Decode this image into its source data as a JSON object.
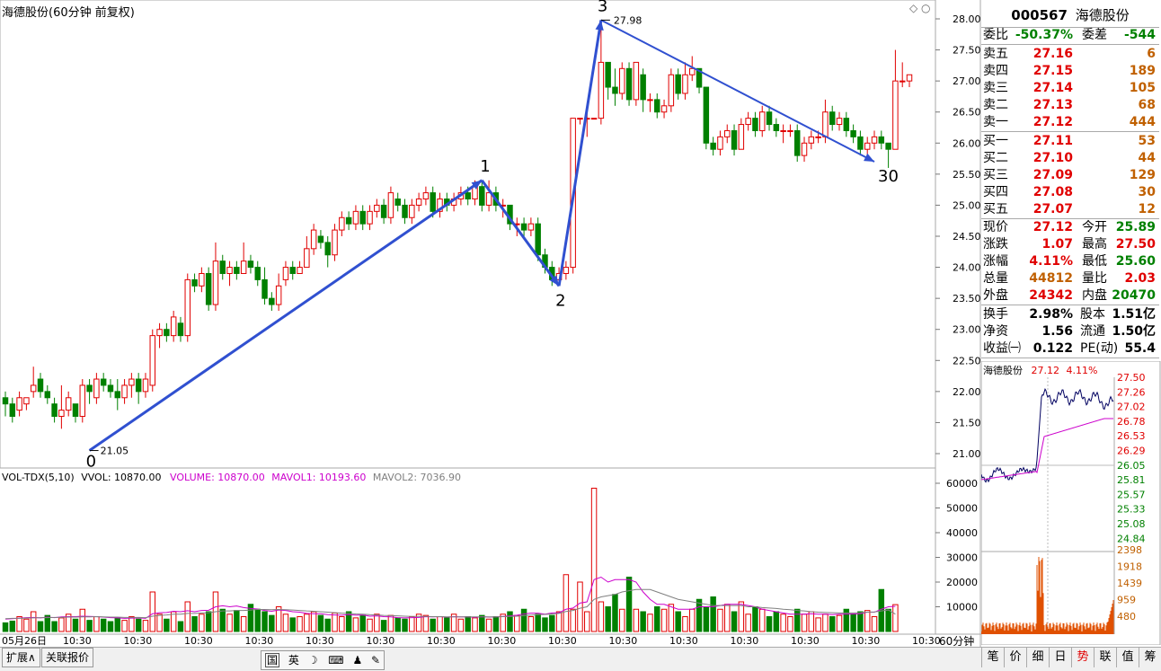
{
  "title": "海德股份(60分钟 前复权)",
  "stock": {
    "code": "000567",
    "name": "海德股份"
  },
  "chart_data": {
    "type": "candlestick",
    "price_axis": {
      "ticks": [
        "28.00",
        "27.50",
        "27.00",
        "26.50",
        "26.00",
        "25.50",
        "25.00",
        "24.50",
        "24.00",
        "23.50",
        "23.00",
        "22.50",
        "22.00",
        "21.50",
        "21.00"
      ],
      "ylim": [
        20.6,
        28.15
      ]
    },
    "candles": [
      [
        21.9,
        21.8,
        22.0,
        21.6
      ],
      [
        21.8,
        21.6,
        21.9,
        21.5
      ],
      [
        21.7,
        21.9,
        22.0,
        21.6
      ],
      [
        21.8,
        21.9,
        21.9,
        21.7
      ],
      [
        22.0,
        22.1,
        22.4,
        21.9
      ],
      [
        22.2,
        22.0,
        22.3,
        21.9
      ],
      [
        22.0,
        21.9,
        22.1,
        21.8
      ],
      [
        21.8,
        21.6,
        21.9,
        21.5
      ],
      [
        21.6,
        21.7,
        22.1,
        21.4
      ],
      [
        21.7,
        21.9,
        22.0,
        21.6
      ],
      [
        21.8,
        21.6,
        21.8,
        21.5
      ],
      [
        21.6,
        22.1,
        22.2,
        21.5
      ],
      [
        22.1,
        22.0,
        22.2,
        21.8
      ],
      [
        21.9,
        22.2,
        22.3,
        21.8
      ],
      [
        22.2,
        22.1,
        22.3,
        22.0
      ],
      [
        22.1,
        22.0,
        22.2,
        21.9
      ],
      [
        22.0,
        21.9,
        22.2,
        21.7
      ],
      [
        21.9,
        22.1,
        22.2,
        21.8
      ],
      [
        22.1,
        22.2,
        22.3,
        21.9
      ],
      [
        22.2,
        22.0,
        22.3,
        21.8
      ],
      [
        22.0,
        22.2,
        22.3,
        21.9
      ],
      [
        22.1,
        22.9,
        23.0,
        22.0
      ],
      [
        22.9,
        23.0,
        23.1,
        22.7
      ],
      [
        23.0,
        22.9,
        23.1,
        22.8
      ],
      [
        22.9,
        23.2,
        23.3,
        22.8
      ],
      [
        23.1,
        22.9,
        23.2,
        22.8
      ],
      [
        22.9,
        23.8,
        23.9,
        22.8
      ],
      [
        23.8,
        23.7,
        23.9,
        23.6
      ],
      [
        23.7,
        23.9,
        24.0,
        23.6
      ],
      [
        23.9,
        23.4,
        24.0,
        23.3
      ],
      [
        23.4,
        24.1,
        24.4,
        23.3
      ],
      [
        24.1,
        23.9,
        24.2,
        23.8
      ],
      [
        23.9,
        24.0,
        24.1,
        23.7
      ],
      [
        24.0,
        23.9,
        24.1,
        23.8
      ],
      [
        23.9,
        24.1,
        24.4,
        23.9
      ],
      [
        24.1,
        24.0,
        24.2,
        23.9
      ],
      [
        24.0,
        23.8,
        24.1,
        23.7
      ],
      [
        23.8,
        23.5,
        24.0,
        23.4
      ],
      [
        23.5,
        23.4,
        23.6,
        23.3
      ],
      [
        23.4,
        23.7,
        23.9,
        23.3
      ],
      [
        23.8,
        24.0,
        24.1,
        23.7
      ],
      [
        24.0,
        23.9,
        24.1,
        23.8
      ],
      [
        23.9,
        24.0,
        24.1,
        23.9
      ],
      [
        24.0,
        24.3,
        24.5,
        24.0
      ],
      [
        24.3,
        24.6,
        24.7,
        24.2
      ],
      [
        24.5,
        24.4,
        24.6,
        24.3
      ],
      [
        24.4,
        24.2,
        24.5,
        24.0
      ],
      [
        24.2,
        24.6,
        24.7,
        24.1
      ],
      [
        24.6,
        24.8,
        24.9,
        24.5
      ],
      [
        24.8,
        24.7,
        24.9,
        24.6
      ],
      [
        24.7,
        24.9,
        25.0,
        24.6
      ],
      [
        24.9,
        24.7,
        25.0,
        24.6
      ],
      [
        24.7,
        24.9,
        25.0,
        24.6
      ],
      [
        24.9,
        25.0,
        25.1,
        24.8
      ],
      [
        25.0,
        24.8,
        25.1,
        24.7
      ],
      [
        24.8,
        25.2,
        25.3,
        24.7
      ],
      [
        25.1,
        25.0,
        25.2,
        24.9
      ],
      [
        25.0,
        24.8,
        25.1,
        24.7
      ],
      [
        24.8,
        25.0,
        25.1,
        24.7
      ],
      [
        25.0,
        25.1,
        25.2,
        24.9
      ],
      [
        25.1,
        25.2,
        25.3,
        25.0
      ],
      [
        25.2,
        24.9,
        25.3,
        24.8
      ],
      [
        24.9,
        25.1,
        25.2,
        24.8
      ],
      [
        25.1,
        25.0,
        25.2,
        24.9
      ],
      [
        25.0,
        25.1,
        25.2,
        24.9
      ],
      [
        25.1,
        25.2,
        25.3,
        25.0
      ],
      [
        25.2,
        25.1,
        25.3,
        25.0
      ],
      [
        25.1,
        25.3,
        25.4,
        25.0
      ],
      [
        25.3,
        25.0,
        25.4,
        24.9
      ],
      [
        25.0,
        25.2,
        25.4,
        24.9
      ],
      [
        25.2,
        25.0,
        25.3,
        24.9
      ],
      [
        25.0,
        25.0,
        25.1,
        24.8
      ],
      [
        25.0,
        24.7,
        25.0,
        24.6
      ],
      [
        24.7,
        24.7,
        24.8,
        24.5
      ],
      [
        24.7,
        24.6,
        24.8,
        24.5
      ],
      [
        24.6,
        24.7,
        24.8,
        24.5
      ],
      [
        24.7,
        24.2,
        24.8,
        24.1
      ],
      [
        24.2,
        24.0,
        24.3,
        23.9
      ],
      [
        24.0,
        23.8,
        24.1,
        23.7
      ],
      [
        23.8,
        23.9,
        24.0,
        23.7
      ],
      [
        23.9,
        24.0,
        24.1,
        23.8
      ],
      [
        24.0,
        26.4,
        26.4,
        23.9
      ],
      [
        26.4,
        26.4,
        26.4,
        26.3
      ],
      [
        26.4,
        26.4,
        26.5,
        26.1
      ],
      [
        26.4,
        26.4,
        26.4,
        26.4
      ],
      [
        26.4,
        27.3,
        27.98,
        26.3
      ],
      [
        27.3,
        26.9,
        27.3,
        26.7
      ],
      [
        26.9,
        26.8,
        27.2,
        26.6
      ],
      [
        26.8,
        27.2,
        27.3,
        26.7
      ],
      [
        27.2,
        26.7,
        27.3,
        26.6
      ],
      [
        26.7,
        27.3,
        27.3,
        26.6
      ],
      [
        27.1,
        26.7,
        27.2,
        26.5
      ],
      [
        26.7,
        26.7,
        26.8,
        26.5
      ],
      [
        26.7,
        26.5,
        26.8,
        26.4
      ],
      [
        26.5,
        26.6,
        26.7,
        26.4
      ],
      [
        26.6,
        27.1,
        27.2,
        26.5
      ],
      [
        27.1,
        26.8,
        27.2,
        26.7
      ],
      [
        26.8,
        27.1,
        27.3,
        26.7
      ],
      [
        27.1,
        27.2,
        27.4,
        27.0
      ],
      [
        27.2,
        26.9,
        27.2,
        26.8
      ],
      [
        26.9,
        26.0,
        26.9,
        25.9
      ],
      [
        26.0,
        25.9,
        26.1,
        25.8
      ],
      [
        25.9,
        26.1,
        26.2,
        25.8
      ],
      [
        26.1,
        26.2,
        26.3,
        26.0
      ],
      [
        26.2,
        25.9,
        26.3,
        25.8
      ],
      [
        25.9,
        26.3,
        26.4,
        25.9
      ],
      [
        26.3,
        26.4,
        26.5,
        26.2
      ],
      [
        26.4,
        26.2,
        26.5,
        26.1
      ],
      [
        26.2,
        26.5,
        26.6,
        26.1
      ],
      [
        26.5,
        26.3,
        26.6,
        26.2
      ],
      [
        26.3,
        26.2,
        26.4,
        26.1
      ],
      [
        26.2,
        26.2,
        26.3,
        26.0
      ],
      [
        26.2,
        26.2,
        26.3,
        26.1
      ],
      [
        26.2,
        25.8,
        26.3,
        25.7
      ],
      [
        25.8,
        26.0,
        26.1,
        25.7
      ],
      [
        26.0,
        26.1,
        26.2,
        25.9
      ],
      [
        26.1,
        26.1,
        26.2,
        26.0
      ],
      [
        26.1,
        26.5,
        26.7,
        26.0
      ],
      [
        26.5,
        26.3,
        26.6,
        26.2
      ],
      [
        26.3,
        26.4,
        26.5,
        26.2
      ],
      [
        26.4,
        26.2,
        26.5,
        26.1
      ],
      [
        26.2,
        26.1,
        26.3,
        26.0
      ],
      [
        26.1,
        25.9,
        26.2,
        25.8
      ],
      [
        25.9,
        26.0,
        26.1,
        25.8
      ],
      [
        26.0,
        26.1,
        26.2,
        25.9
      ],
      [
        26.1,
        26.0,
        26.2,
        25.9
      ],
      [
        26.0,
        25.9,
        26.0,
        25.6
      ],
      [
        25.9,
        27.0,
        27.5,
        25.9
      ],
      [
        27.0,
        27.0,
        27.3,
        26.9
      ],
      [
        27.0,
        27.1,
        27.1,
        26.9
      ]
    ],
    "zigzag": {
      "points": [
        [
          12,
          21.05
        ],
        [
          68,
          25.4
        ],
        [
          79,
          23.7
        ],
        [
          85,
          27.98
        ],
        [
          124,
          25.7
        ]
      ],
      "labels": [
        "0",
        "1",
        "2",
        "3",
        "30"
      ],
      "price_labels": [
        "21.05",
        "27.98"
      ]
    },
    "volume": {
      "header": [
        "VOL-TDX(5,10)",
        "VVOL: 10870.00",
        "VOLUME: 10870.00",
        "MAVOL1: 10193.60",
        "MAVOL2: 7036.90"
      ],
      "ticks": [
        "60000",
        "50000",
        "40000",
        "30000",
        "20000",
        "10000"
      ],
      "ylim": [
        0,
        63000
      ],
      "values": [
        3500,
        4200,
        6000,
        5000,
        8000,
        4000,
        6500,
        4000,
        5500,
        7000,
        5000,
        9000,
        4500,
        6000,
        5000,
        4000,
        5500,
        4500,
        6000,
        5000,
        4500,
        16000,
        7000,
        5000,
        8000,
        4000,
        12000,
        6000,
        7000,
        8000,
        16000,
        9000,
        7000,
        8500,
        6000,
        11000,
        9000,
        8000,
        6500,
        10000,
        7000,
        5500,
        6000,
        7000,
        8000,
        6500,
        5000,
        7500,
        6000,
        8000,
        5500,
        6500,
        5000,
        7000,
        4500,
        6500,
        5500,
        5000,
        6000,
        7000,
        6500,
        5000,
        6000,
        5500,
        7000,
        5000,
        6000,
        5500,
        6500,
        5000,
        6000,
        7000,
        8000,
        6500,
        9000,
        6000,
        7000,
        5500,
        6500,
        8000,
        23000,
        9000,
        20000,
        8000,
        58000,
        12000,
        10000,
        15000,
        9000,
        22000,
        9000,
        8000,
        7000,
        10000,
        9000,
        11000,
        8000,
        6000,
        9000,
        13000,
        10000,
        14000,
        9000,
        11000,
        8000,
        12000,
        7000,
        10000,
        9000,
        6000,
        8000,
        7000,
        6000,
        9000,
        7000,
        8000,
        5500,
        7000,
        6000,
        6500,
        9000,
        7000,
        8000,
        8500,
        6000,
        17000,
        9000,
        10870
      ],
      "mavol1": [
        5000,
        5200,
        5400,
        5600,
        5700,
        5500,
        5800,
        5600,
        5900,
        6000,
        6000,
        6200,
        6100,
        6000,
        5800,
        5600,
        5500,
        5300,
        5400,
        5500,
        5300,
        7200,
        7600,
        7700,
        8200,
        8000,
        8400,
        8000,
        8500,
        8600,
        10000,
        10400,
        10000,
        10300,
        9700,
        9300,
        9100,
        8500,
        8200,
        8700,
        8500,
        8000,
        7800,
        7300,
        7200,
        7200,
        6800,
        6700,
        6600,
        6800,
        6600,
        6700,
        6200,
        6300,
        6000,
        5900,
        5600,
        5500,
        5600,
        5700,
        6000,
        5900,
        6000,
        5800,
        6000,
        5900,
        5900,
        5700,
        6000,
        5800,
        5900,
        6100,
        6300,
        6600,
        7100,
        7400,
        7400,
        7000,
        7500,
        7600,
        9000,
        9500,
        11500,
        12000,
        21000,
        22000,
        20000,
        21000,
        21000,
        21000,
        20000,
        16000,
        13000,
        11000,
        11000,
        10000,
        9000,
        9000,
        9000,
        10000,
        10000,
        10000,
        10500,
        11000,
        11000,
        11000,
        10500,
        10000,
        9000,
        8500,
        8000,
        7500,
        7000,
        7000,
        7000,
        7200,
        7000,
        7000,
        6800,
        7000,
        7000,
        7100,
        7200,
        7800,
        7800,
        9000,
        10000,
        10193
      ],
      "mavol2": [
        5200,
        5300,
        5300,
        5400,
        5500,
        5600,
        5600,
        5700,
        5700,
        5800,
        5800,
        5900,
        5900,
        6000,
        5900,
        5800,
        5800,
        5700,
        5700,
        5700,
        5600,
        6200,
        6500,
        6700,
        7000,
        7000,
        7300,
        7300,
        7500,
        7600,
        8000,
        8300,
        8300,
        8500,
        8500,
        8700,
        8900,
        8900,
        8800,
        8900,
        8800,
        8700,
        8500,
        8300,
        8200,
        8000,
        7800,
        7600,
        7400,
        7300,
        7100,
        7000,
        6800,
        6700,
        6500,
        6400,
        6300,
        6200,
        6100,
        6100,
        6100,
        6000,
        6000,
        5900,
        5900,
        5900,
        5900,
        5900,
        5900,
        5900,
        5900,
        6000,
        6100,
        6200,
        6400,
        6600,
        6800,
        6900,
        7100,
        7300,
        8100,
        8500,
        9400,
        10000,
        13000,
        14000,
        14500,
        15000,
        16000,
        16500,
        17000,
        17000,
        17000,
        16000,
        15000,
        14000,
        13000,
        12500,
        12000,
        11500,
        11000,
        10500,
        10500,
        10500,
        10500,
        10500,
        10000,
        10000,
        9700,
        9500,
        9300,
        9000,
        8800,
        8500,
        8300,
        8000,
        7800,
        7700,
        7600,
        7500,
        7500,
        7500,
        7600,
        7800,
        7900,
        8300,
        8700,
        7036
      ]
    },
    "x_labels": [
      "05月26日",
      "10:30",
      "10:30",
      "10:30",
      "10:30",
      "10:30",
      "10:30",
      "10:30",
      "10:30",
      "10:30",
      "10:30",
      "10:30",
      "10:30",
      "10:30",
      "10:30",
      "10:30"
    ],
    "period_label": "60分钟"
  },
  "quote": {
    "weibi_label": "委比",
    "weibi": "-50.37%",
    "weicha_label": "委差",
    "weicha": "-544",
    "asks": [
      [
        "卖五",
        "27.16",
        "6"
      ],
      [
        "卖四",
        "27.15",
        "189"
      ],
      [
        "卖三",
        "27.14",
        "105"
      ],
      [
        "卖二",
        "27.13",
        "68"
      ],
      [
        "卖一",
        "27.12",
        "444"
      ]
    ],
    "bids": [
      [
        "买一",
        "27.11",
        "53"
      ],
      [
        "买二",
        "27.10",
        "44"
      ],
      [
        "买三",
        "27.09",
        "129"
      ],
      [
        "买四",
        "27.08",
        "30"
      ],
      [
        "买五",
        "27.07",
        "12"
      ]
    ],
    "stats": [
      [
        "现价",
        "27.12",
        "今开",
        "25.89"
      ],
      [
        "涨跌",
        "1.07",
        "最高",
        "27.50"
      ],
      [
        "涨幅",
        "4.11%",
        "最低",
        "25.60"
      ],
      [
        "总量",
        "44812",
        "量比",
        "2.03"
      ],
      [
        "外盘",
        "24342",
        "内盘",
        "20470"
      ]
    ],
    "fin": [
      [
        "换手",
        "2.98%",
        "股本",
        "1.51亿"
      ],
      [
        "净资",
        "1.56",
        "流通",
        "1.50亿"
      ],
      [
        "收益㈠",
        "0.122",
        "PE(动)",
        "55.4"
      ]
    ]
  },
  "mini": {
    "name": "海德股份",
    "price": "27.12",
    "pct": "4.11%",
    "price_ticks": [
      "27.50",
      "27.26",
      "27.02",
      "26.78",
      "26.53",
      "26.29",
      "26.05",
      "25.81",
      "25.57",
      "25.33",
      "25.08",
      "24.84"
    ],
    "vol_ticks": [
      "2398",
      "1918",
      "1439",
      "959",
      "480"
    ]
  },
  "bottom_tabs": [
    "扩展∧",
    "关联报价"
  ],
  "ime": [
    "国",
    "英",
    "☽",
    "⌨",
    "♟",
    "✎"
  ],
  "right_tabs": [
    "笔",
    "价",
    "细",
    "日",
    "势",
    "联",
    "值",
    "筹"
  ],
  "colors": {
    "up": "#e00000",
    "down": "#008000",
    "zig": "#3050d0",
    "ma1": "#cc00cc",
    "ma2": "#808080"
  }
}
